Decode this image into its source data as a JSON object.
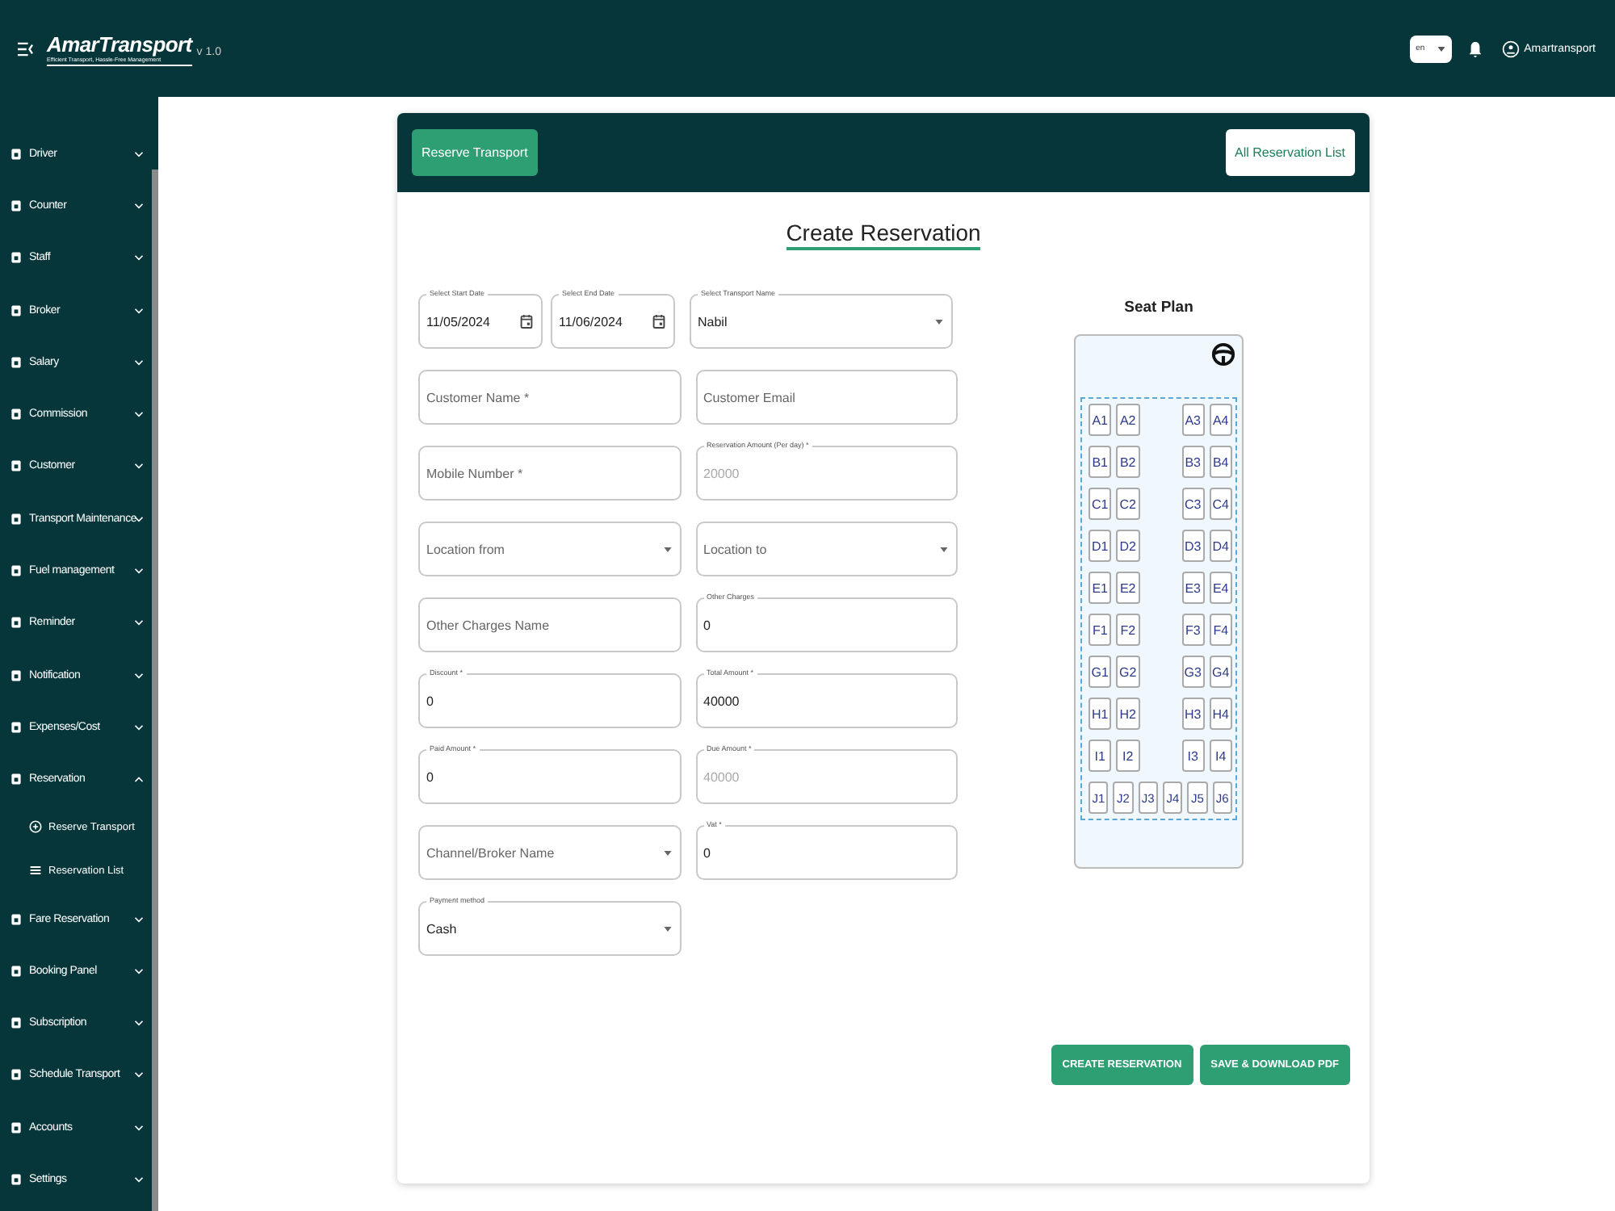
{
  "header": {
    "brand": "AmarTransport",
    "tagline": "Efficient Transport, Hassle-Free Management",
    "version": "v 1.0",
    "language": "en",
    "user": "Amartransport"
  },
  "sidebar": {
    "items": [
      {
        "label": "Driver",
        "expanded": false
      },
      {
        "label": "Counter",
        "expanded": false
      },
      {
        "label": "Staff",
        "expanded": false
      },
      {
        "label": "Broker",
        "expanded": false
      },
      {
        "label": "Salary",
        "expanded": false
      },
      {
        "label": "Commission",
        "expanded": false
      },
      {
        "label": "Customer",
        "expanded": false
      },
      {
        "label": "Transport Maintenance",
        "expanded": false
      },
      {
        "label": "Fuel management",
        "expanded": false
      },
      {
        "label": "Reminder",
        "expanded": false
      },
      {
        "label": "Notification",
        "expanded": false
      },
      {
        "label": "Expenses/Cost",
        "expanded": false
      },
      {
        "label": "Reservation",
        "expanded": true,
        "children": [
          {
            "label": "Reserve Transport"
          },
          {
            "label": "Reservation List"
          }
        ]
      },
      {
        "label": "Fare Reservation",
        "expanded": false
      },
      {
        "label": "Booking Panel",
        "expanded": false
      },
      {
        "label": "Subscription",
        "expanded": false
      },
      {
        "label": "Schedule Transport",
        "expanded": false
      },
      {
        "label": "Accounts",
        "expanded": false
      },
      {
        "label": "Settings",
        "expanded": false
      }
    ]
  },
  "card": {
    "buttons": [
      "Reserve Transport",
      "All Reservation List"
    ],
    "title": "Create Reservation",
    "form": [
      [
        {
          "kind": "date",
          "label": "Select Start Date",
          "value": "11/05/2024"
        },
        {
          "kind": "date",
          "label": "Select End Date",
          "value": "11/06/2024"
        },
        {
          "kind": "select",
          "label": "Select Transport Name",
          "value": "Nabil"
        }
      ],
      [
        {
          "kind": "text",
          "placeholder": "Customer Name *"
        },
        {
          "kind": "text",
          "placeholder": "Customer Email"
        }
      ],
      [
        {
          "kind": "text",
          "placeholder": "Mobile Number *"
        },
        {
          "kind": "text",
          "label": "Reservation Amount (Per day) *",
          "value": "20000",
          "disabled": true
        }
      ],
      [
        {
          "kind": "select",
          "placeholder": "Location from"
        },
        {
          "kind": "select",
          "placeholder": "Location to"
        }
      ],
      [
        {
          "kind": "text",
          "placeholder": "Other Charges Name"
        },
        {
          "kind": "text",
          "label": "Other Charges",
          "value": "0"
        }
      ],
      [
        {
          "kind": "text",
          "label": "Discount *",
          "value": "0"
        },
        {
          "kind": "text",
          "label": "Total Amount *",
          "value": "40000"
        }
      ],
      [
        {
          "kind": "text",
          "label": "Paid Amount *",
          "value": "0"
        },
        {
          "kind": "text",
          "label": "Due Amount *",
          "value": "40000",
          "disabled": true
        }
      ],
      [
        {
          "kind": "select",
          "placeholder": "Channel/Broker Name"
        },
        {
          "kind": "text",
          "label": "Vat *",
          "value": "0"
        }
      ],
      [
        {
          "kind": "select",
          "label": "Payment method",
          "value": "Cash"
        }
      ]
    ],
    "seat_plan": {
      "title": "Seat Plan",
      "rows": [
        [
          "A1",
          "A2",
          "A3",
          "A4"
        ],
        [
          "B1",
          "B2",
          "B3",
          "B4"
        ],
        [
          "C1",
          "C2",
          "C3",
          "C4"
        ],
        [
          "D1",
          "D2",
          "D3",
          "D4"
        ],
        [
          "E1",
          "E2",
          "E3",
          "E4"
        ],
        [
          "F1",
          "F2",
          "F3",
          "F4"
        ],
        [
          "G1",
          "G2",
          "G3",
          "G4"
        ],
        [
          "H1",
          "H2",
          "H3",
          "H4"
        ],
        [
          "I1",
          "I2",
          "I3",
          "I4"
        ],
        [
          "J1",
          "J2",
          "J3",
          "J4",
          "J5",
          "J6"
        ]
      ]
    },
    "actions": [
      "CREATE RESERVATION",
      "SAVE & DOWNLOAD PDF"
    ]
  }
}
